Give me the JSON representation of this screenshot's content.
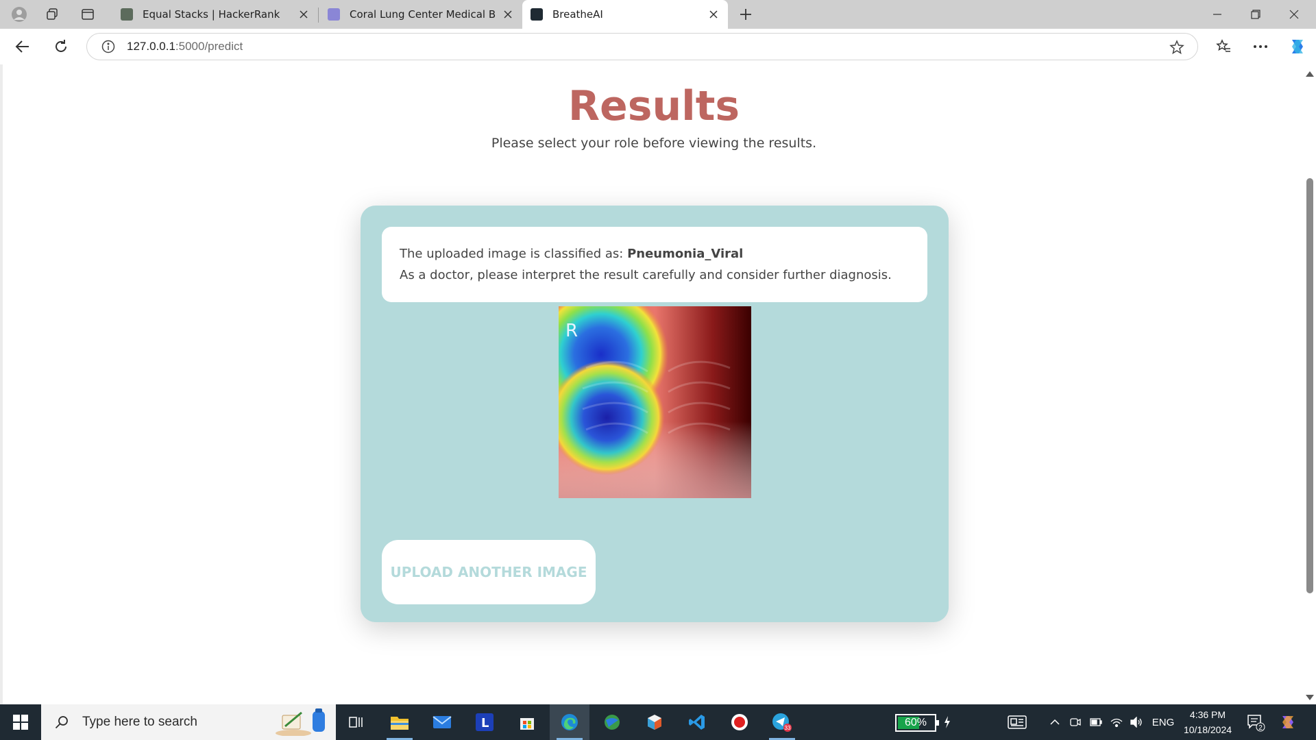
{
  "browser": {
    "tabs": [
      {
        "title": "Equal Stacks | HackerRank",
        "favicon": "hackerrank-icon"
      },
      {
        "title": "Coral Lung Center Medical Busine",
        "favicon": "doc-icon"
      },
      {
        "title": "BreatheAI",
        "favicon": "terminal-icon",
        "active": true
      }
    ],
    "url_host": "127.0.0.1",
    "url_path": ":5000/predict"
  },
  "page": {
    "title": "Results",
    "subtitle": "Please select your role before viewing the results.",
    "result_prefix": "The uploaded image is classified as: ",
    "classification": "Pneumonia_Viral",
    "doctor_note": "As a doctor, please interpret the result carefully and consider further diagnosis.",
    "xray_marker": "R",
    "upload_button": "UPLOAD ANOTHER IMAGE"
  },
  "taskbar": {
    "search_placeholder": "Type here to search",
    "battery": "60%",
    "battery_level": 0.6,
    "language": "ENG",
    "time": "4:36 PM",
    "date": "10/18/2024",
    "telegram_badge": "33",
    "notifications_badge": "2"
  },
  "colors": {
    "title": "#bd6660",
    "card": "#b4dadb",
    "taskbar": "#1f2a33"
  }
}
